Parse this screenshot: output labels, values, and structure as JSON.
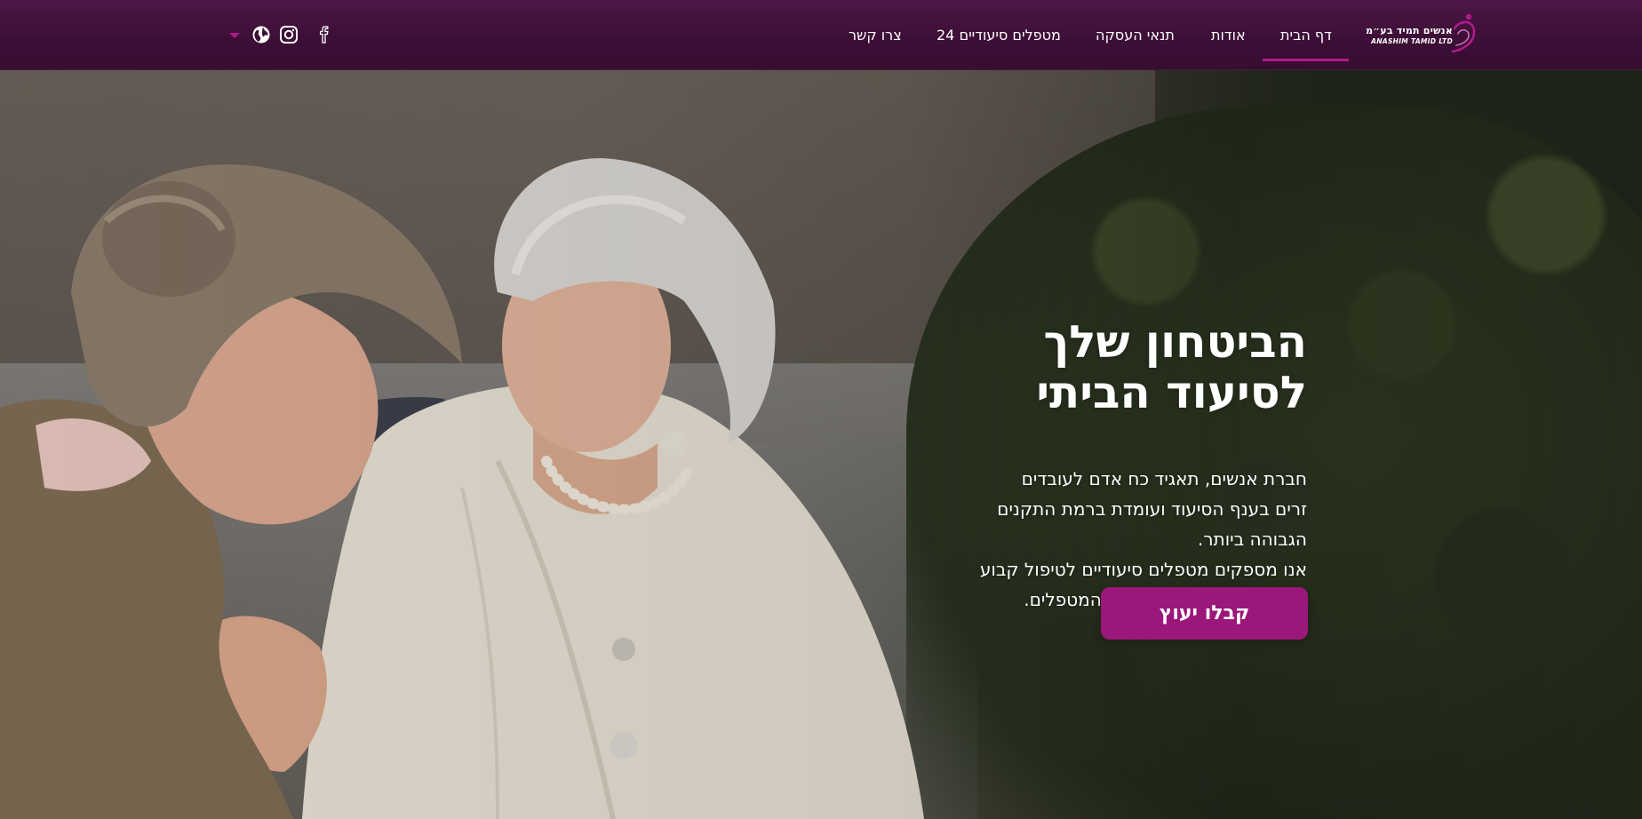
{
  "brand": {
    "logo_he": "אנשים תמיד בע״מ",
    "logo_en": "ANASHIM TAMID LTD",
    "accent_color": "#9b1779",
    "header_color": "#3d0f37"
  },
  "nav": {
    "items": [
      {
        "label": "דף הבית",
        "active": true
      },
      {
        "label": "אודות"
      },
      {
        "label": "תנאי העסקה"
      },
      {
        "label": "מטפלים סיעודיים 24"
      },
      {
        "label": "צרו קשר"
      }
    ],
    "icons": [
      "facebook-icon",
      "instagram-icon",
      "globe-icon",
      "chevron-down-icon"
    ]
  },
  "hero": {
    "title_line1": "הביטחון שלך",
    "title_line2": "לסיעוד הביתי",
    "desc_line1": "חברת אנשים, תאגיד כח אדם לעובדים",
    "desc_line2": "זרים בענף הסיעוד ועומדת ברמת התקנים",
    "desc_line3": "הגבוהה ביותר.",
    "desc_line4": "אנו מספקים מטפלים סיעודיים לטיפול קבוע",
    "desc_line5": "תוך מתן דגש על מקצועיות המטפלים.",
    "cta_label": "קבלו יעוץ"
  }
}
